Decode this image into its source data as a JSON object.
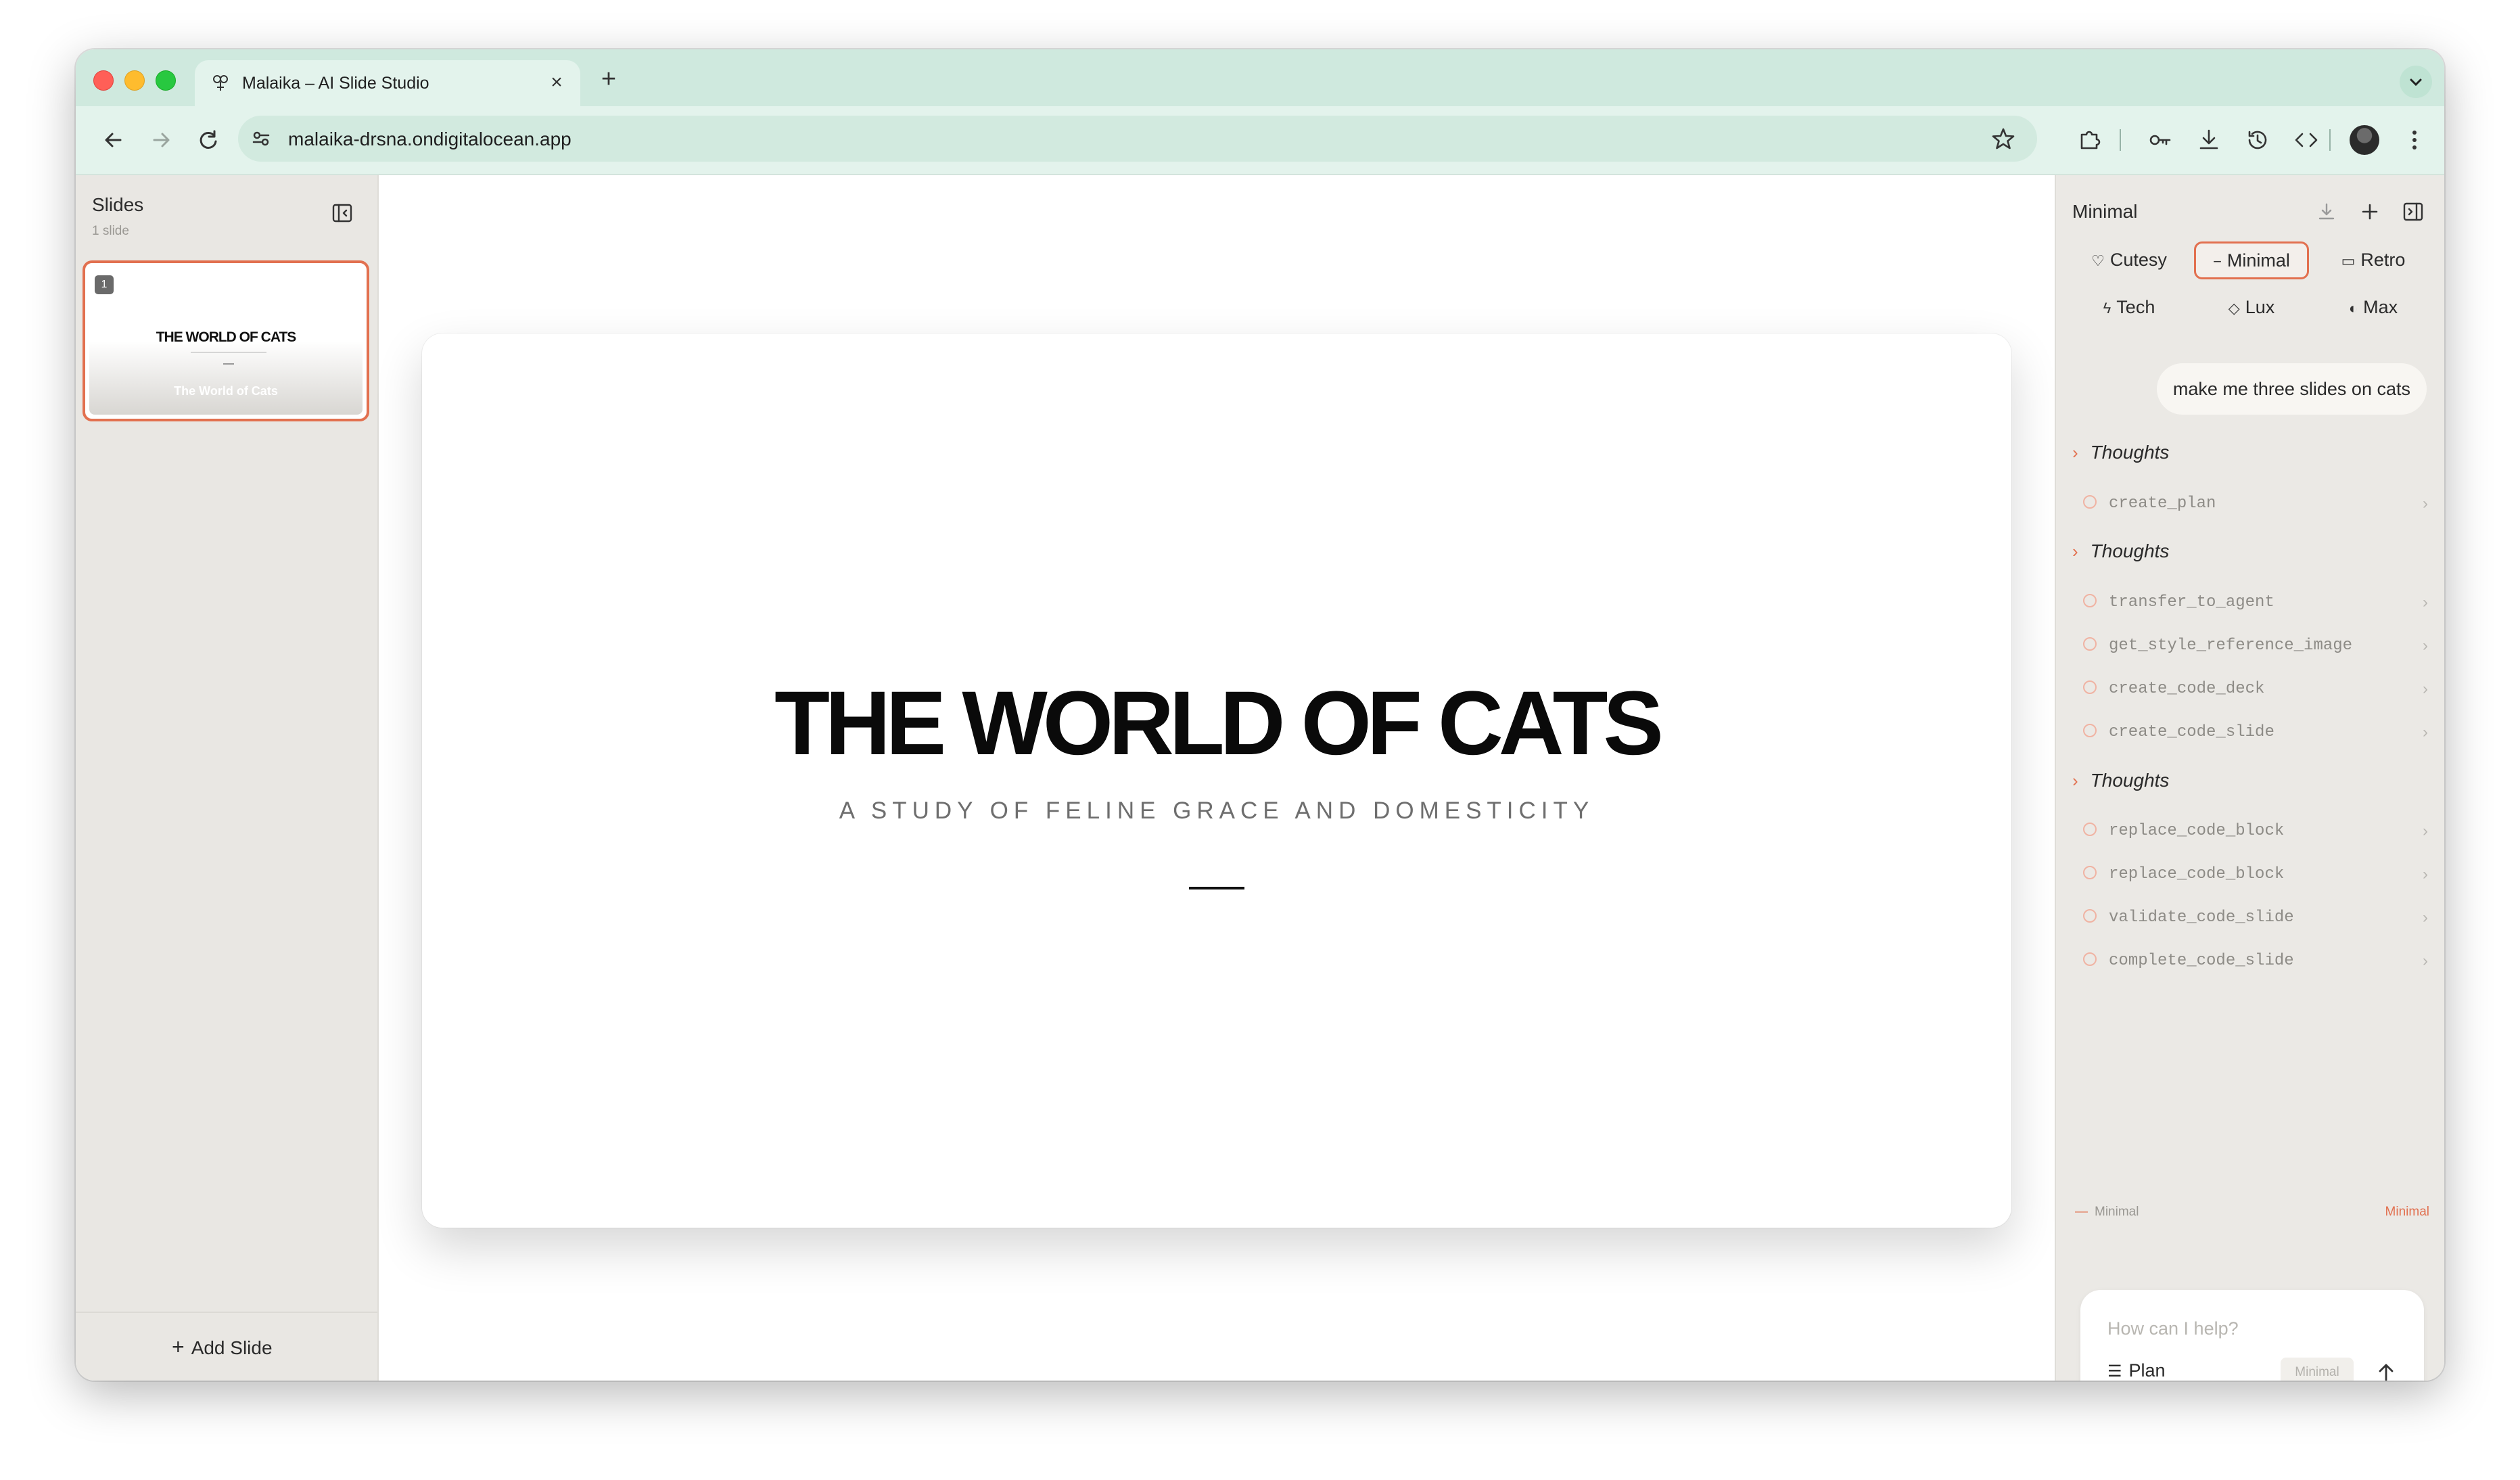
{
  "browser": {
    "tab_title": "Malaika – AI Slide Studio",
    "tab_close": "×",
    "new_tab": "+",
    "url": "malaika-drsna.ondigitalocean.app"
  },
  "sidebar": {
    "title": "Slides",
    "count": "1 slide",
    "thumbnail": {
      "number": "1",
      "title": "THE WORLD OF CATS",
      "caption": "The World of Cats"
    },
    "add_slide_icon": "+",
    "add_slide_label": "Add Slide"
  },
  "slide": {
    "title": "THE WORLD OF CATS",
    "subtitle": "A STUDY OF FELINE GRACE AND DOMESTICITY"
  },
  "panel": {
    "title": "Minimal",
    "styles": [
      {
        "label": "Cutesy",
        "icon": "heart-icon",
        "glyph": "♡"
      },
      {
        "label": "Minimal",
        "icon": "minus-icon",
        "glyph": "−"
      },
      {
        "label": "Retro",
        "icon": "tv-icon",
        "glyph": "▭"
      },
      {
        "label": "Tech",
        "icon": "bolt-icon",
        "glyph": "ϟ"
      },
      {
        "label": "Lux",
        "icon": "gem-icon",
        "glyph": "◇"
      },
      {
        "label": "Max",
        "icon": "palette-icon",
        "glyph": "◐"
      }
    ],
    "active_style": "Minimal",
    "user_message": "make me three slides on cats",
    "thoughts_label": "Thoughts",
    "tools": {
      "create_plan": "create_plan",
      "transfer_to_agent": "transfer_to_agent",
      "get_style_reference_image": "get_style_reference_image",
      "create_code_deck": "create_code_deck",
      "create_code_slide": "create_code_slide",
      "replace_code_block_1": "replace_code_block",
      "replace_code_block_2": "replace_code_block",
      "validate_code_slide": "validate_code_slide",
      "complete_code_slide": "complete_code_slide"
    },
    "mode_left": "Minimal",
    "mode_right": "Minimal",
    "composer_placeholder": "How can I help?",
    "plan_label": "Plan",
    "mode_chip": "Minimal"
  },
  "colors": {
    "accent": "#e2704f",
    "tabstrip": "#cfe9de",
    "sidebar_bg": "#e9e7e3"
  }
}
